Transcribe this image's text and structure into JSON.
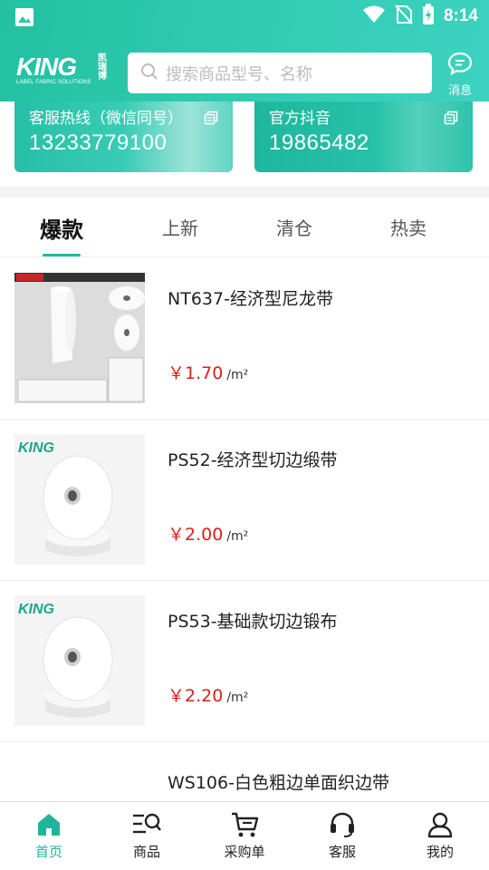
{
  "status_bar": {
    "time": "8:14"
  },
  "header": {
    "logo": {
      "text": "KING",
      "cn": "凯瑞博",
      "sub": "LABEL FABRIC SOLUTIONS"
    },
    "search_placeholder": "搜索商品型号、名称",
    "message_label": "消息"
  },
  "contact_cards": [
    {
      "title": "客服热线（微信同号）",
      "value": "13233779100",
      "icon": "copy-icon"
    },
    {
      "title": "官方抖音",
      "value": "19865482",
      "icon": "copy-icon"
    }
  ],
  "tabs": [
    {
      "label": "爆款",
      "active": true
    },
    {
      "label": "上新",
      "active": false
    },
    {
      "label": "清仓",
      "active": false
    },
    {
      "label": "热卖",
      "active": false
    }
  ],
  "products": [
    {
      "name": "NT637-经济型尼龙带",
      "price": "￥1.70",
      "unit": "/m²",
      "image": "spec-sheet-roll"
    },
    {
      "name": "PS52-经济型切边缎带",
      "price": "￥2.00",
      "unit": "/m²",
      "image": "king-roll"
    },
    {
      "name": "PS53-基础款切边锻布",
      "price": "￥2.20",
      "unit": "/m²",
      "image": "king-roll"
    },
    {
      "name": "WS106-白色粗边单面织边带",
      "price": "",
      "unit": "",
      "image": ""
    }
  ],
  "bottom_nav": [
    {
      "label": "首页",
      "icon": "home-icon",
      "active": true
    },
    {
      "label": "商品",
      "icon": "product-search-icon",
      "active": false
    },
    {
      "label": "采购单",
      "icon": "cart-icon",
      "active": false
    },
    {
      "label": "客服",
      "icon": "headset-icon",
      "active": false
    },
    {
      "label": "我的",
      "icon": "user-icon",
      "active": false
    }
  ],
  "colors": {
    "brand": "#22c1a3",
    "price": "#d9201b",
    "active_nav": "#1fb59b"
  }
}
